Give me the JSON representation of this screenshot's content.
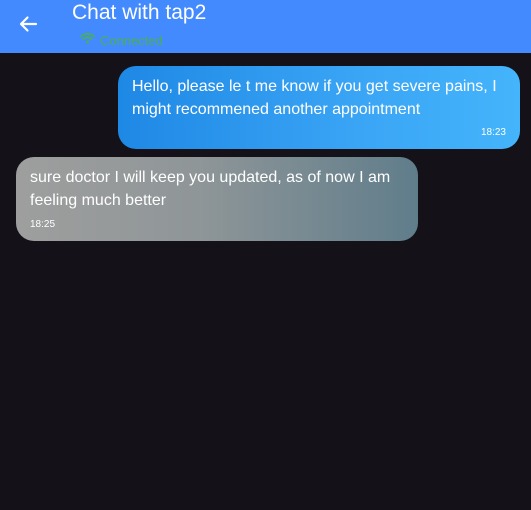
{
  "appbar": {
    "title": "Chat with tap2",
    "status": "Connected",
    "back_icon": "arrow-back-icon",
    "status_icon": "wifi-icon",
    "colors": {
      "appbar_bg": "#448aff",
      "status_text": "#4caf50"
    }
  },
  "messages": [
    {
      "direction": "sent",
      "text": "Hello, please le t me know if you get severe pains, I might recommened another appointment",
      "time": "18:23"
    },
    {
      "direction": "received",
      "text": "sure doctor I will keep you updated, as of now I am feeling much better",
      "time": "18:25"
    }
  ],
  "colors": {
    "background": "#141218",
    "sent_bubble": "#2196f3",
    "received_bubble": "#8f9698"
  }
}
